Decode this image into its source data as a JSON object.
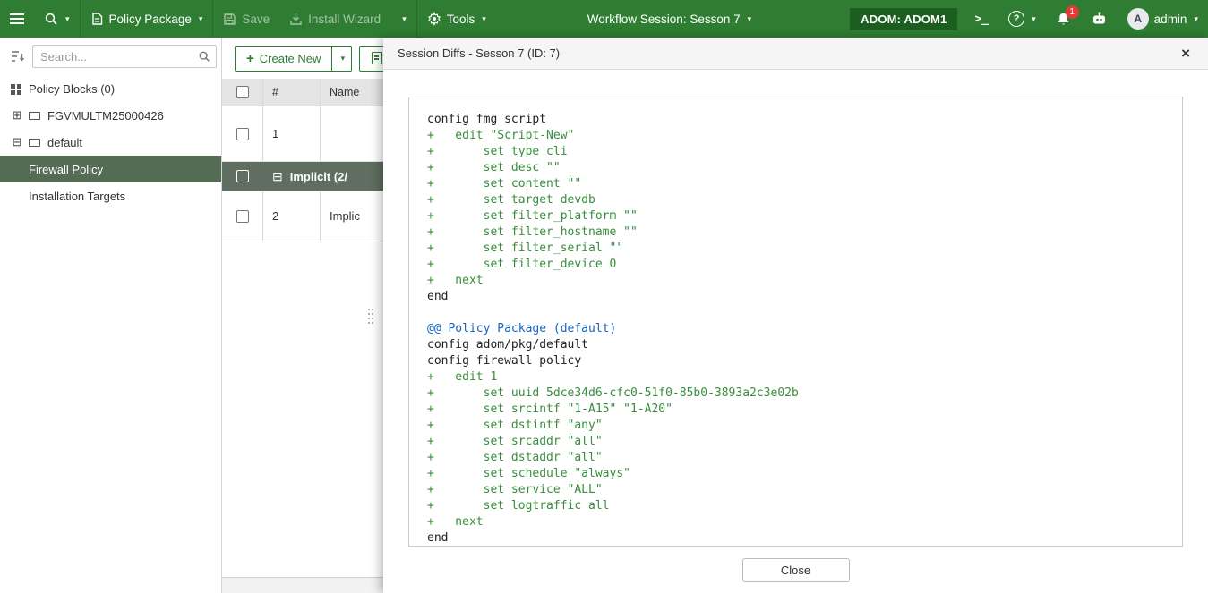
{
  "colors": {
    "navbar_green": "#2e7d32",
    "adom_badge_green": "#1b5e20",
    "selected_tree_item": "#546b54",
    "section_row": "#5f6e60",
    "diff_add": "#388e3c",
    "diff_hunk": "#1565c0",
    "notification_badge": "#e53935"
  },
  "navbar": {
    "policy_package_label": "Policy Package",
    "save_label": "Save",
    "install_wizard_label": "Install Wizard",
    "tools_label": "Tools",
    "workflow_label": "Workflow Session: Sesson 7",
    "adom_label": "ADOM: ADOM1",
    "terminal_glyph": ">_",
    "help_glyph": "?",
    "notification_count": "1",
    "avatar_letter": "A",
    "user_label": "admin"
  },
  "sidebar": {
    "search_placeholder": "Search...",
    "items": [
      {
        "label": "Policy Blocks (0)",
        "icon": "policy-blocks-icon"
      },
      {
        "label": "FGVMULTM25000426",
        "icon": "device-icon",
        "expander": "collapsed"
      },
      {
        "label": "default",
        "icon": "device-icon",
        "expander": "expanded"
      },
      {
        "label": "Firewall Policy",
        "selected": true,
        "indent": true
      },
      {
        "label": "Installation Targets",
        "indent": true
      }
    ]
  },
  "content": {
    "toolbar": {
      "create_new_label": "Create New",
      "plus_glyph": "+"
    },
    "table": {
      "col_num_header": "#",
      "col_name_header": "Name",
      "rows": [
        {
          "type": "policy",
          "num": "1",
          "name": "",
          "height_class": "row-policy-1"
        },
        {
          "type": "section",
          "label": "Implicit (2/"
        },
        {
          "type": "policy",
          "num": "2",
          "name": "Implic",
          "height_class": "row-policy-2"
        }
      ]
    }
  },
  "modal": {
    "title": "Session Diffs - Sesson 7 (ID: 7)",
    "close_glyph": "×",
    "close_button_label": "Close",
    "diff_lines": [
      {
        "text": "config fmg script",
        "kind": "plain"
      },
      {
        "text": "+   edit \"Script-New\"",
        "kind": "add"
      },
      {
        "text": "+       set type cli",
        "kind": "add"
      },
      {
        "text": "+       set desc \"\"",
        "kind": "add"
      },
      {
        "text": "+       set content \"\"",
        "kind": "add"
      },
      {
        "text": "+       set target devdb",
        "kind": "add"
      },
      {
        "text": "+       set filter_platform \"\"",
        "kind": "add"
      },
      {
        "text": "+       set filter_hostname \"\"",
        "kind": "add"
      },
      {
        "text": "+       set filter_serial \"\"",
        "kind": "add"
      },
      {
        "text": "+       set filter_device 0",
        "kind": "add"
      },
      {
        "text": "+   next",
        "kind": "add"
      },
      {
        "text": "end",
        "kind": "plain"
      },
      {
        "text": "",
        "kind": "plain"
      },
      {
        "text": "@@ Policy Package (default)",
        "kind": "hunk"
      },
      {
        "text": "config adom/pkg/default",
        "kind": "plain"
      },
      {
        "text": "config firewall policy",
        "kind": "plain"
      },
      {
        "text": "+   edit 1",
        "kind": "add"
      },
      {
        "text": "+       set uuid 5dce34d6-cfc0-51f0-85b0-3893a2c3e02b",
        "kind": "add"
      },
      {
        "text": "+       set srcintf \"1-A15\" \"1-A20\"",
        "kind": "add"
      },
      {
        "text": "+       set dstintf \"any\"",
        "kind": "add"
      },
      {
        "text": "+       set srcaddr \"all\"",
        "kind": "add"
      },
      {
        "text": "+       set dstaddr \"all\"",
        "kind": "add"
      },
      {
        "text": "+       set schedule \"always\"",
        "kind": "add"
      },
      {
        "text": "+       set service \"ALL\"",
        "kind": "add"
      },
      {
        "text": "+       set logtraffic all",
        "kind": "add"
      },
      {
        "text": "+   next",
        "kind": "add"
      },
      {
        "text": "end",
        "kind": "plain"
      }
    ]
  }
}
